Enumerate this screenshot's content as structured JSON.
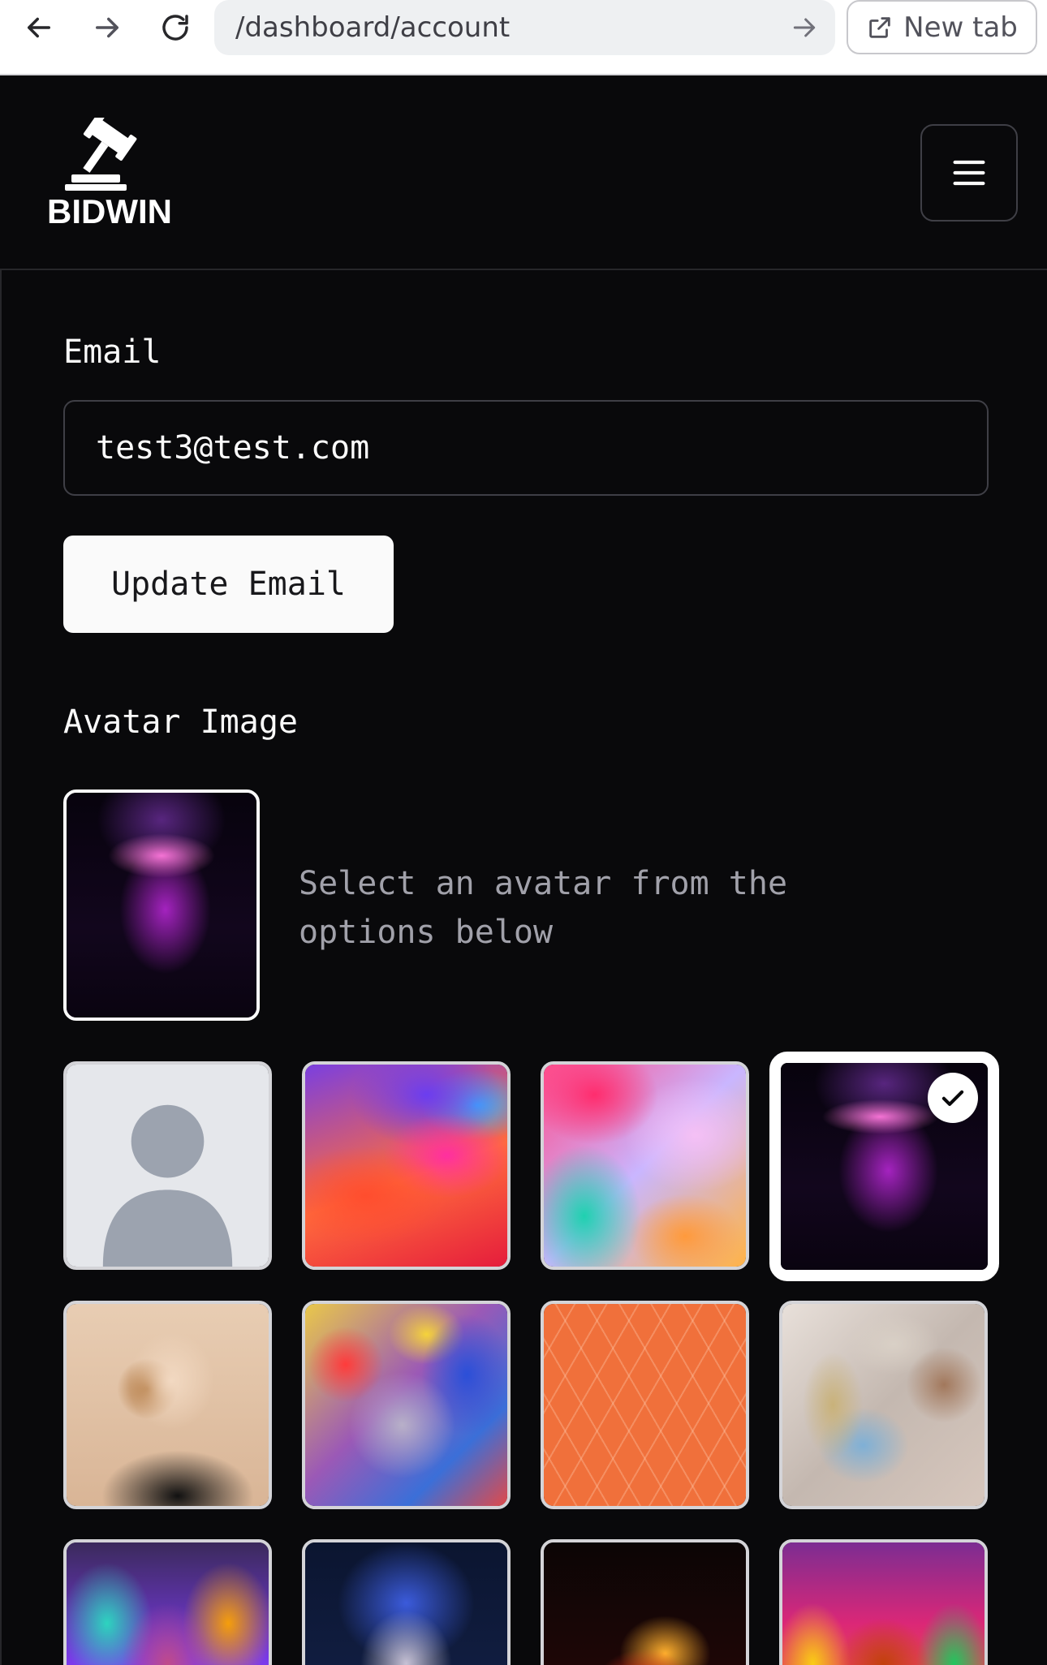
{
  "browser": {
    "url": "/dashboard/account",
    "new_tab_label": "New tab"
  },
  "header": {
    "logo_text": "BIDWIN"
  },
  "account": {
    "email_label": "Email",
    "email_value": "test3@test.com",
    "update_email_label": "Update Email",
    "avatar_label": "Avatar Image",
    "avatar_hint": "Select an avatar from the options below"
  },
  "colors": {
    "background": "#09090b",
    "text": "#fafafa",
    "muted_text": "#a1a1aa",
    "border": "#3f3f46"
  },
  "avatars": {
    "selected_index": 3,
    "options": [
      "default-person-placeholder",
      "abstract-paint-purple-red",
      "alcohol-ink-pink-teal",
      "neon-glasses-portrait",
      "butterfly-face-portrait",
      "graffiti-face",
      "orange-leaf-pattern",
      "liquid-metal-abstract",
      "rainbow-hair-portrait",
      "blue-smoke-portrait",
      "fire-embrace",
      "colorful-paint-face"
    ]
  }
}
